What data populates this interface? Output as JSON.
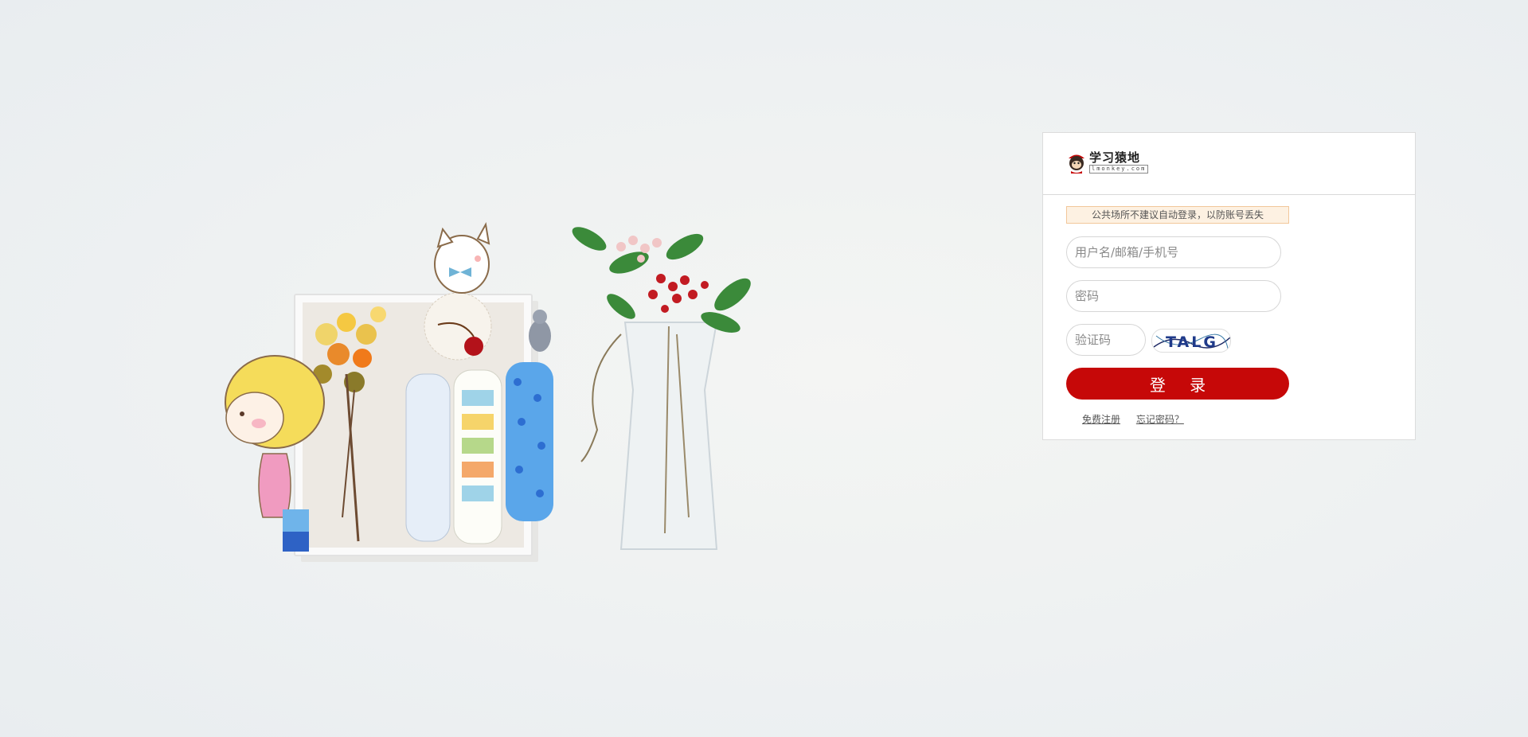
{
  "logo": {
    "main": "学习猿地",
    "sub": "lmonkey.com"
  },
  "notice": "公共场所不建议自动登录，以防账号丢失",
  "form": {
    "username_placeholder": "用户名/邮箱/手机号",
    "password_placeholder": "密码",
    "captcha_placeholder": "验证码",
    "captcha_text": "TALG",
    "login_label": "登 录"
  },
  "links": {
    "register": "免费注册",
    "forgot": "忘记密码？"
  },
  "colors": {
    "accent": "#c60808",
    "notice_bg": "#fdf1e2",
    "notice_border": "#f2c79a"
  }
}
